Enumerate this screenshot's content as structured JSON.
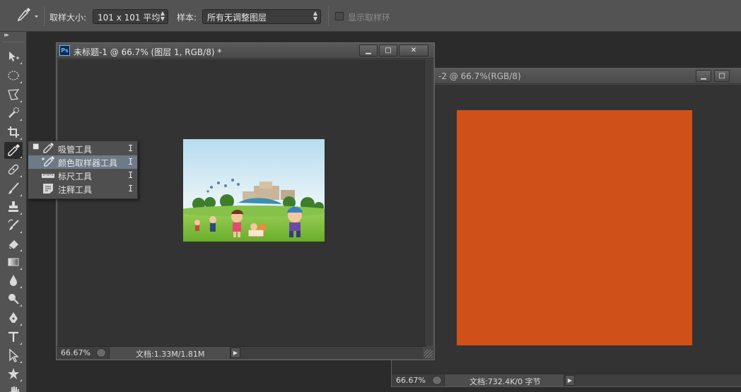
{
  "options": {
    "sample_size_label": "取样大小:",
    "sample_size_value": "101 x 101 平均",
    "sample_label": "样本:",
    "sample_value": "所有无调整图层",
    "show_ring_label": "显示取样环"
  },
  "flyout": {
    "items": [
      {
        "label": "吸管工具",
        "key": "I",
        "selected": true
      },
      {
        "label": "颜色取样器工具",
        "key": "I",
        "selected": false
      },
      {
        "label": "标尺工具",
        "key": "I",
        "selected": false
      },
      {
        "label": "注释工具",
        "key": "I",
        "selected": false
      }
    ]
  },
  "doc1": {
    "ps_badge": "Ps",
    "title": "未标题-1 @ 66.7% (图层 1, RGB/8) *",
    "zoom": "66.67%",
    "doc_info": "文档:1.33M/1.81M",
    "minimize": "▁",
    "maximize": "□",
    "close": "✕"
  },
  "doc2": {
    "title": "-2 @ 66.7%(RGB/8)",
    "zoom": "66.67%",
    "doc_info": "文档:732.4K/0 字节",
    "minimize": "▁",
    "maximize": "□",
    "fill_color": "#cf5119"
  },
  "colors": {
    "options_bar": "#535353",
    "workspace": "#2b2b2b",
    "canvas_bg": "#333333",
    "orange_canvas": "#cf5119",
    "flyout_highlight": "#6e7a88"
  }
}
